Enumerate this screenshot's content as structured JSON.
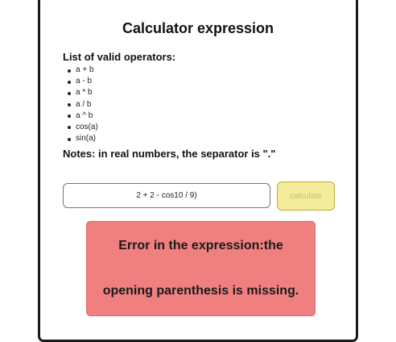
{
  "title": "Calculator expression",
  "operators": {
    "heading": "List of valid operators:",
    "items": [
      "a + b",
      "a - b",
      "a * b",
      "a / b",
      "a ^ b",
      "cos(a)",
      "sin(a)"
    ]
  },
  "notes": "Notes: in real numbers, the separator is \".\"",
  "expression": {
    "value": "2 + 2 - cos10 / 9)"
  },
  "calculate_label": "calculate",
  "error": {
    "line1": "Error in the expression:the",
    "line2": "opening parenthesis is missing."
  },
  "colors": {
    "button_bg": "#f4ec9a",
    "error_bg": "#f08080"
  }
}
